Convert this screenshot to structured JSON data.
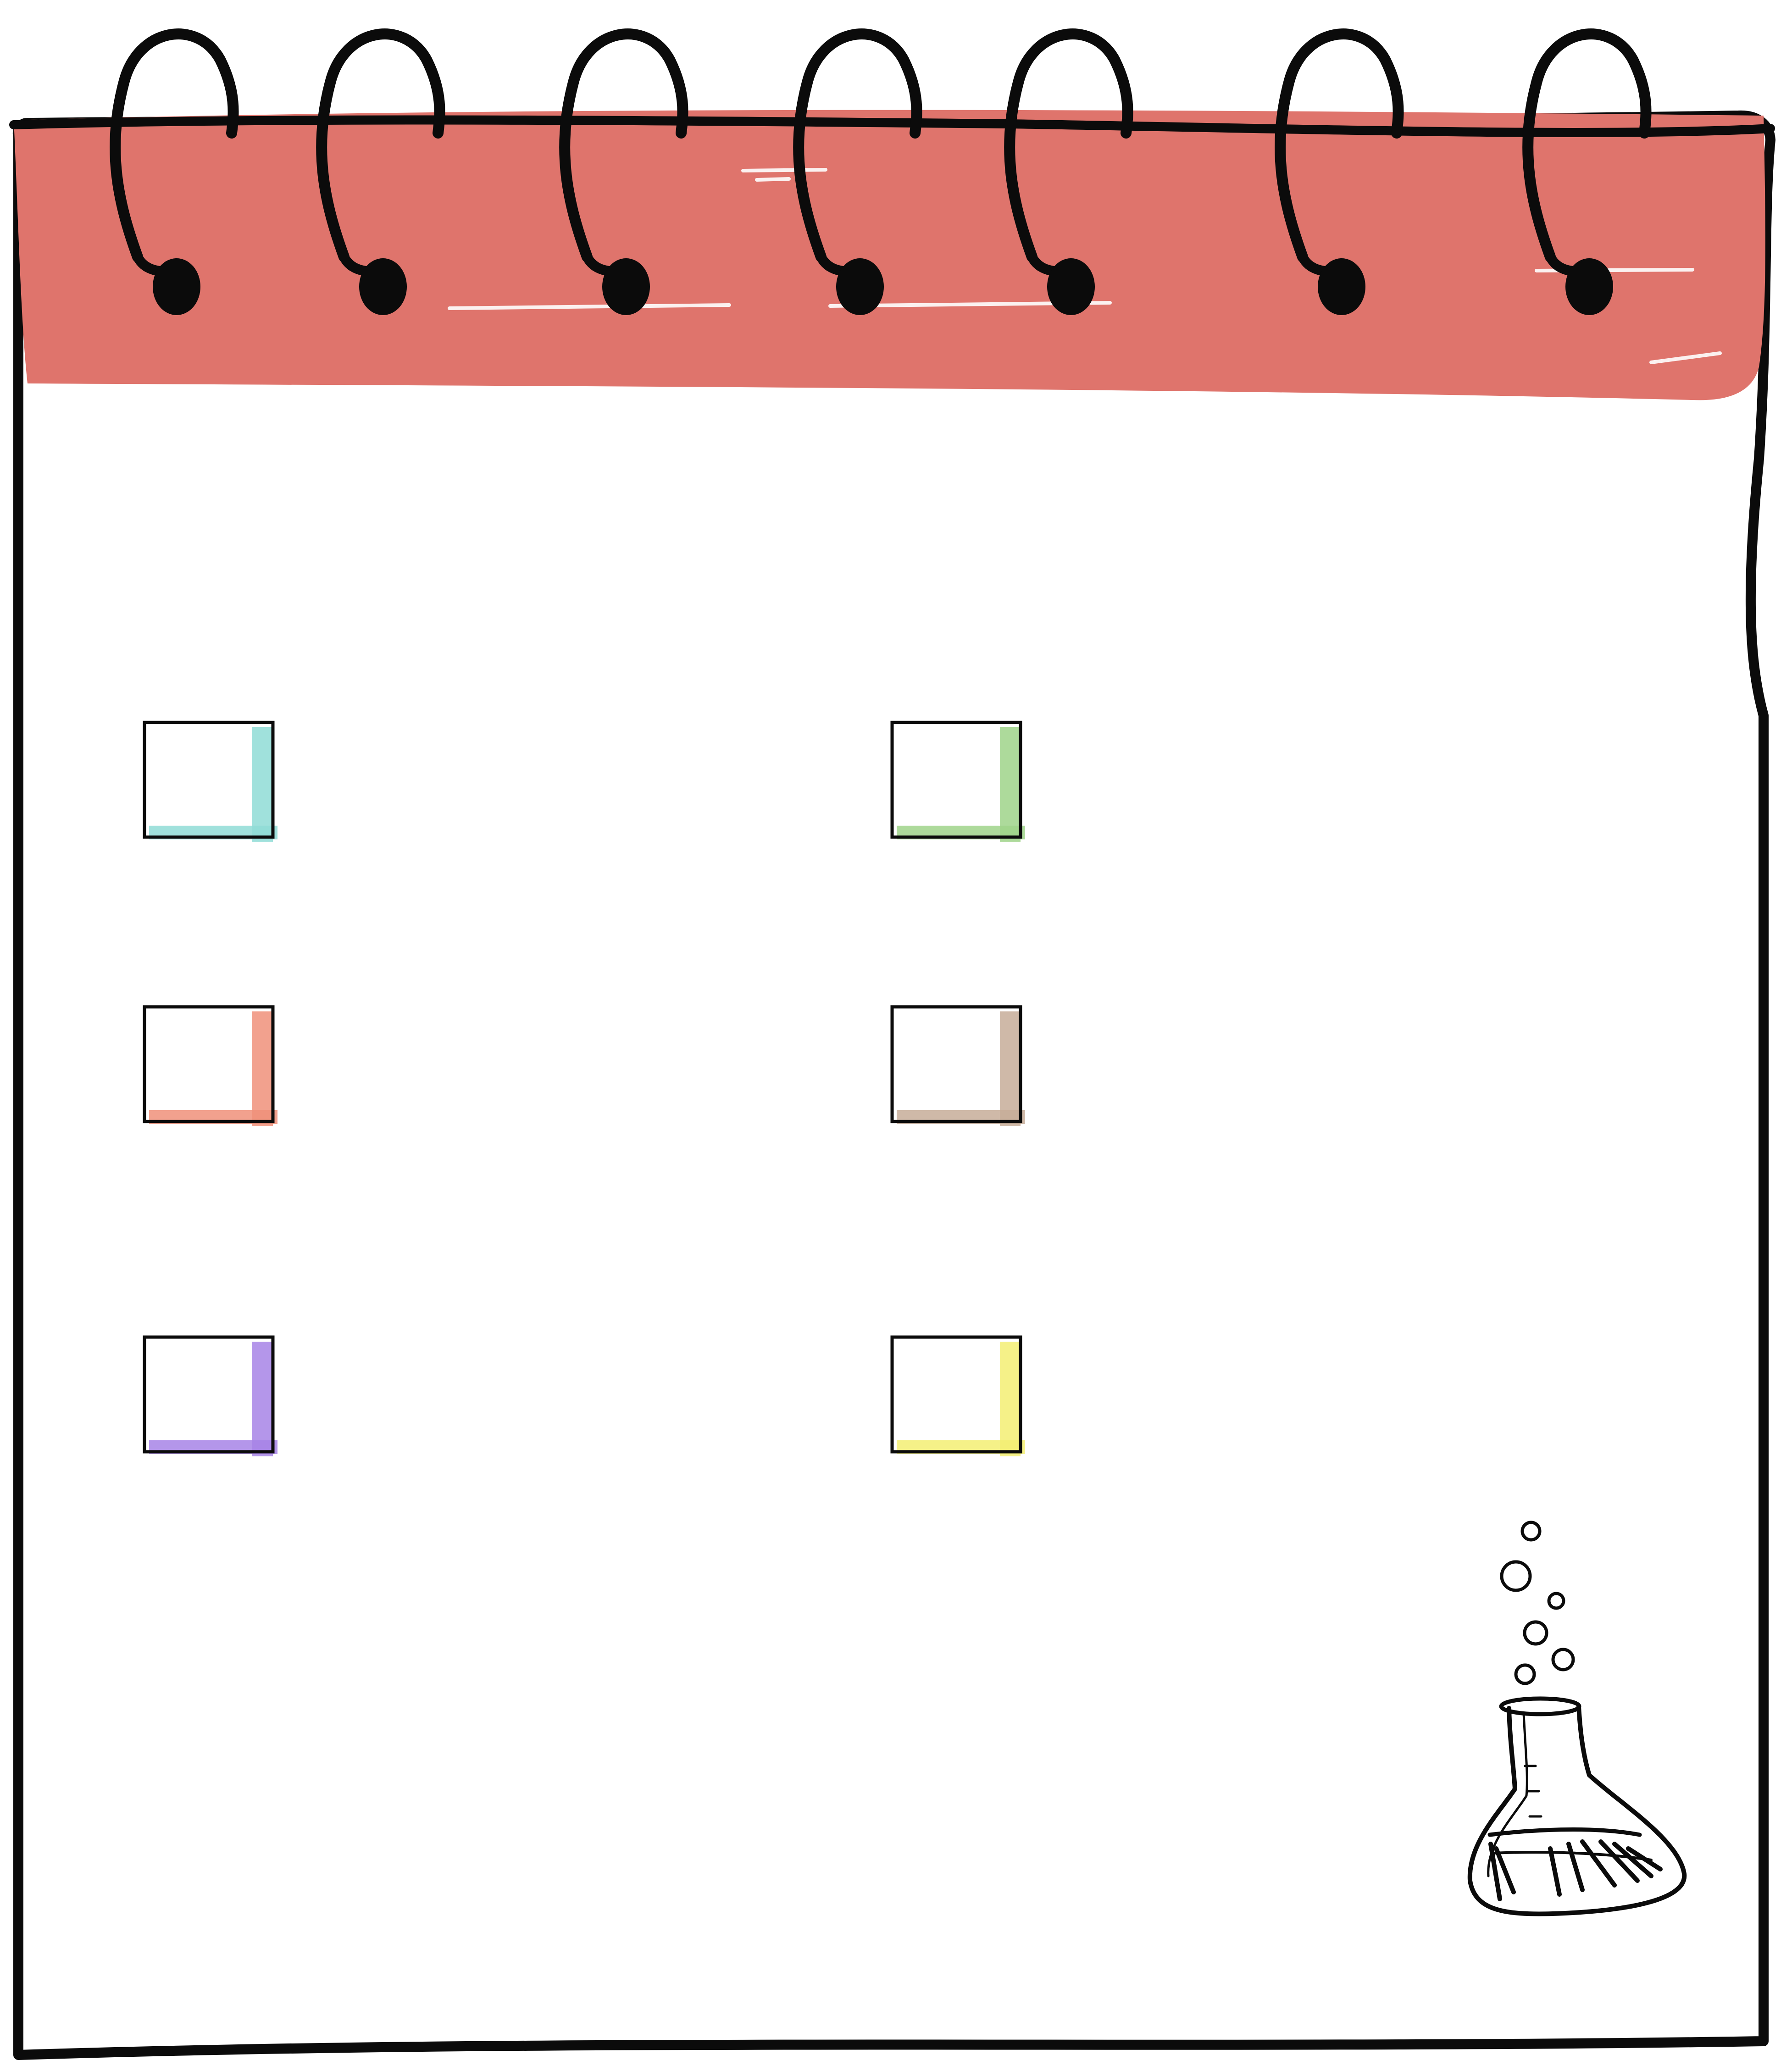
{
  "colors": {
    "background": "#ffffff",
    "header": "#df746c",
    "header_highlight": "#ffffff",
    "ink": "#0b0b0b"
  },
  "spiral": {
    "ring_count": 7
  },
  "checklist": {
    "items": [
      {
        "id": "item-1",
        "column": "left",
        "row": 1,
        "checked": false,
        "accent": "#8fdcd6"
      },
      {
        "id": "item-2",
        "column": "right",
        "row": 1,
        "checked": false,
        "accent": "#9fd48a"
      },
      {
        "id": "item-3",
        "column": "left",
        "row": 2,
        "checked": false,
        "accent": "#f0917a"
      },
      {
        "id": "item-4",
        "column": "right",
        "row": 2,
        "checked": false,
        "accent": "#c7ad99"
      },
      {
        "id": "item-5",
        "column": "left",
        "row": 3,
        "checked": false,
        "accent": "#a784e6"
      },
      {
        "id": "item-6",
        "column": "right",
        "row": 3,
        "checked": false,
        "accent": "#f3ee73"
      }
    ]
  },
  "decoration": {
    "icon": "flask-icon"
  }
}
